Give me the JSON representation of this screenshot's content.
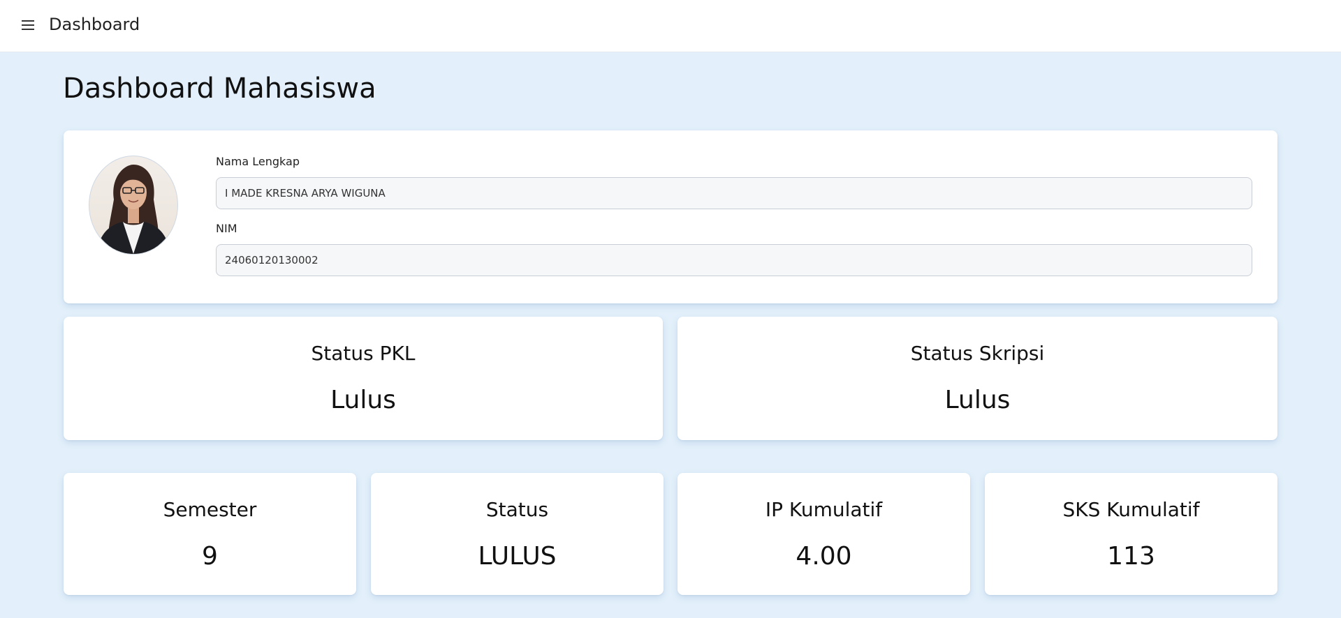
{
  "topbar": {
    "menu_icon": "hamburger-menu-icon",
    "title": "Dashboard"
  },
  "page": {
    "title": "Dashboard Mahasiswa"
  },
  "profile": {
    "avatar": "student-photo",
    "name_label": "Nama Lengkap",
    "name_value": "I MADE KRESNA ARYA WIGUNA",
    "nim_label": "NIM",
    "nim_value": "24060120130002"
  },
  "status_cards": [
    {
      "title": "Status PKL",
      "value": "Lulus"
    },
    {
      "title": "Status Skripsi",
      "value": "Lulus"
    }
  ],
  "stat_cards": [
    {
      "title": "Semester",
      "value": "9"
    },
    {
      "title": "Status",
      "value": "LULUS"
    },
    {
      "title": "IP Kumulatif",
      "value": "4.00"
    },
    {
      "title": "SKS Kumulatif",
      "value": "113"
    }
  ],
  "colors": {
    "background": "#e3f0fb",
    "card": "#ffffff",
    "input_bg": "#f6f7f9"
  }
}
